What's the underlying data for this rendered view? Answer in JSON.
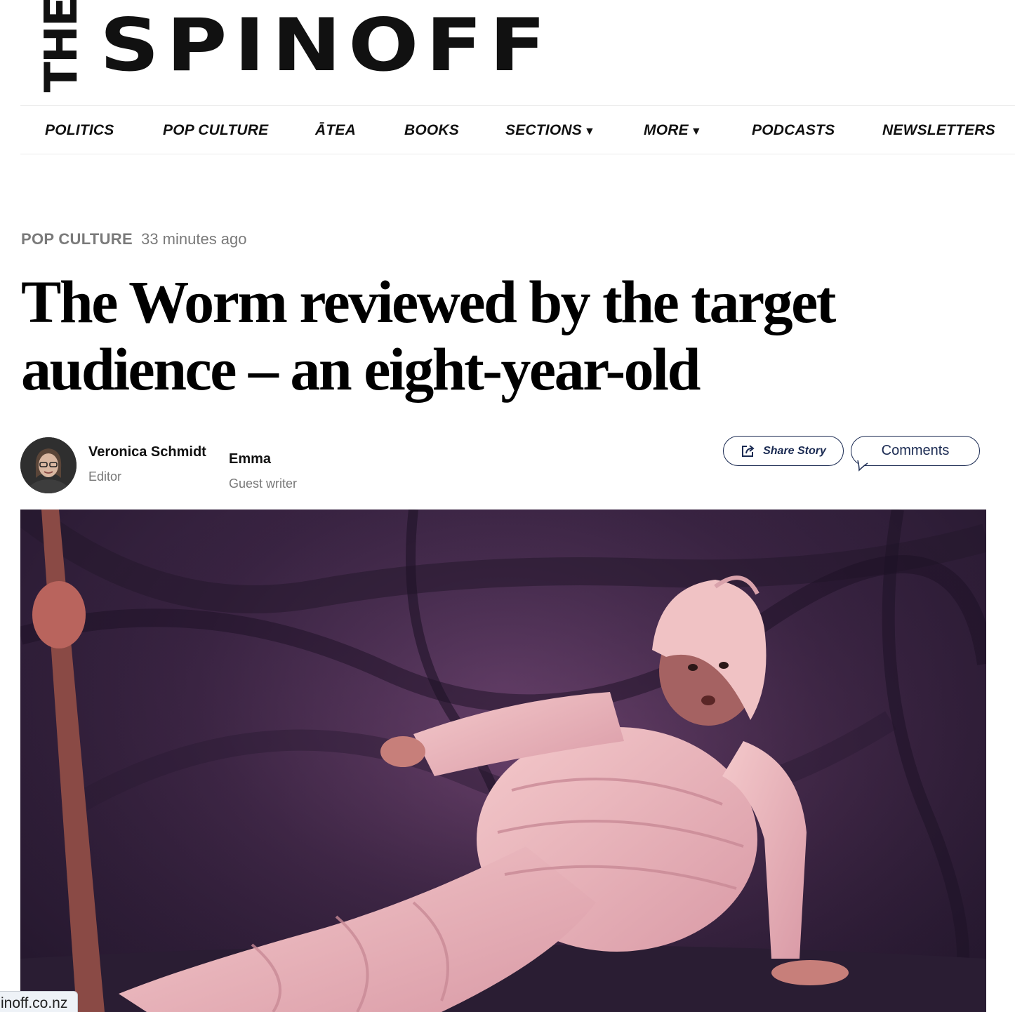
{
  "logo": {
    "prefix": "THE",
    "word": "SPINOFF"
  },
  "nav": {
    "items": [
      {
        "label": "POLITICS"
      },
      {
        "label": "POP CULTURE"
      },
      {
        "label": "ĀTEA"
      },
      {
        "label": "BOOKS"
      },
      {
        "label": "SECTIONS",
        "dropdown": true
      },
      {
        "label": "MORE",
        "dropdown": true
      },
      {
        "label": "PODCASTS"
      },
      {
        "label": "NEWSLETTERS"
      }
    ],
    "caret": "▼"
  },
  "article": {
    "section": "POP CULTURE",
    "time": "33 minutes ago",
    "headline": "The Worm reviewed by the target audience – an eight-year-old",
    "authors": [
      {
        "name": "Veronica Schmidt",
        "role": "Editor"
      },
      {
        "name": "Emma",
        "role": "Guest writer"
      }
    ],
    "share_label": "Share Story",
    "comments_label": "Comments"
  },
  "status_url": "inoff.co.nz"
}
